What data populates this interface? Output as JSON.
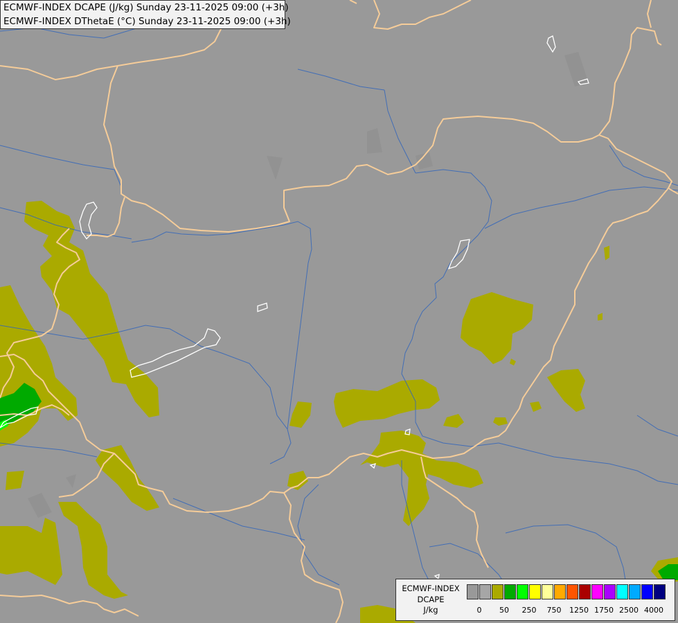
{
  "title": {
    "line1": "ECMWF-INDEX DCAPE (J/kg) Sunday 23-11-2025 09:00 (+3h)",
    "line2": "ECMWF-INDEX DThetaE (°C) Sunday 23-11-2025 09:00 (+3h)"
  },
  "legend": {
    "label_line1": "ECMWF-INDEX",
    "label_line2": "DCAPE",
    "label_line3": "J/kg",
    "colors": [
      "#999999",
      "#a6a6a6",
      "#aaaa00",
      "#00aa00",
      "#00ff00",
      "#ffff00",
      "#ffff99",
      "#ffaa00",
      "#ff5500",
      "#aa0000",
      "#ff00ff",
      "#aa00ff",
      "#00ffff",
      "#00aaff",
      "#0000ff",
      "#000080"
    ],
    "ticks": [
      "0",
      "50",
      "250",
      "750",
      "1250",
      "1750",
      "2500",
      "4000"
    ]
  },
  "map_colors": {
    "background": "#999999",
    "border": "#f5cc99",
    "river": "#3366bb",
    "lake": "#ffffff",
    "dcape_50": "#aaaa00",
    "dcape_250": "#00aa00",
    "dcape_750": "#00ff00"
  }
}
